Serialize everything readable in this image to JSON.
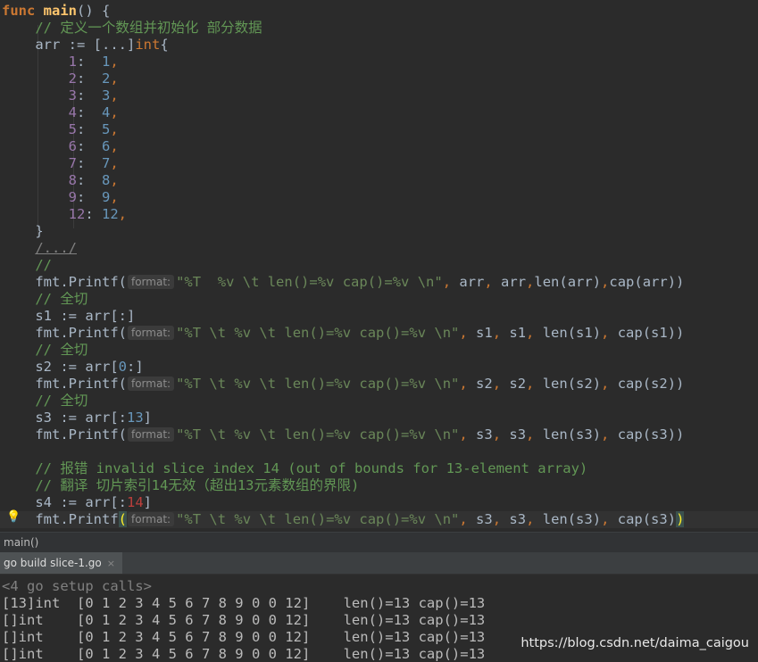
{
  "editor": {
    "lines": [
      {
        "indent": "",
        "parts": [
          {
            "t": "func",
            "c": "kw"
          },
          {
            "t": " "
          },
          {
            "t": "main",
            "c": "fn"
          },
          {
            "t": "() {"
          }
        ]
      },
      {
        "indent": "    ",
        "parts": [
          {
            "t": "// 定义一个数组并初始化 部分数据",
            "c": "cm"
          }
        ]
      },
      {
        "indent": "    ",
        "parts": [
          {
            "t": "arr := [...]"
          },
          {
            "t": "int",
            "c": "kw2"
          },
          {
            "t": "{"
          }
        ]
      },
      {
        "indent": "        ",
        "parts": [
          {
            "t": "1",
            "c": "key"
          },
          {
            "t": ":  "
          },
          {
            "t": "1",
            "c": "num"
          },
          {
            "t": ",",
            "c": "punc"
          }
        ]
      },
      {
        "indent": "        ",
        "parts": [
          {
            "t": "2",
            "c": "key"
          },
          {
            "t": ":  "
          },
          {
            "t": "2",
            "c": "num"
          },
          {
            "t": ",",
            "c": "punc"
          }
        ]
      },
      {
        "indent": "        ",
        "parts": [
          {
            "t": "3",
            "c": "key"
          },
          {
            "t": ":  "
          },
          {
            "t": "3",
            "c": "num"
          },
          {
            "t": ",",
            "c": "punc"
          }
        ]
      },
      {
        "indent": "        ",
        "parts": [
          {
            "t": "4",
            "c": "key"
          },
          {
            "t": ":  "
          },
          {
            "t": "4",
            "c": "num"
          },
          {
            "t": ",",
            "c": "punc"
          }
        ]
      },
      {
        "indent": "        ",
        "parts": [
          {
            "t": "5",
            "c": "key"
          },
          {
            "t": ":  "
          },
          {
            "t": "5",
            "c": "num"
          },
          {
            "t": ",",
            "c": "punc"
          }
        ]
      },
      {
        "indent": "        ",
        "parts": [
          {
            "t": "6",
            "c": "key"
          },
          {
            "t": ":  "
          },
          {
            "t": "6",
            "c": "num"
          },
          {
            "t": ",",
            "c": "punc"
          }
        ]
      },
      {
        "indent": "        ",
        "parts": [
          {
            "t": "7",
            "c": "key"
          },
          {
            "t": ":  "
          },
          {
            "t": "7",
            "c": "num"
          },
          {
            "t": ",",
            "c": "punc"
          }
        ]
      },
      {
        "indent": "        ",
        "parts": [
          {
            "t": "8",
            "c": "key"
          },
          {
            "t": ":  "
          },
          {
            "t": "8",
            "c": "num"
          },
          {
            "t": ",",
            "c": "punc"
          }
        ]
      },
      {
        "indent": "        ",
        "parts": [
          {
            "t": "9",
            "c": "key"
          },
          {
            "t": ":  "
          },
          {
            "t": "9",
            "c": "num"
          },
          {
            "t": ",",
            "c": "punc"
          }
        ]
      },
      {
        "indent": "        ",
        "parts": [
          {
            "t": "12",
            "c": "key"
          },
          {
            "t": ": "
          },
          {
            "t": "12",
            "c": "num"
          },
          {
            "t": ",",
            "c": "punc"
          }
        ]
      },
      {
        "indent": "    ",
        "parts": [
          {
            "t": "}"
          }
        ]
      },
      {
        "indent": "    ",
        "parts": [
          {
            "t": "/.../",
            "c": "fold-comment"
          }
        ]
      },
      {
        "indent": "    ",
        "parts": [
          {
            "t": "//",
            "c": "cm"
          }
        ]
      },
      {
        "indent": "    ",
        "parts": [
          {
            "t": "fmt.Printf("
          },
          {
            "hint": "format:"
          },
          {
            "t": "\"%T  %v \\t len()=%v cap()=%v \\n\"",
            "c": "str"
          },
          {
            "t": ", ",
            "c": "punc"
          },
          {
            "t": "arr"
          },
          {
            "t": ", ",
            "c": "punc"
          },
          {
            "t": "arr"
          },
          {
            "t": ",",
            "c": "punc"
          },
          {
            "t": "len(arr)"
          },
          {
            "t": ",",
            "c": "punc"
          },
          {
            "t": "cap(arr))"
          }
        ]
      },
      {
        "indent": "    ",
        "parts": [
          {
            "t": "// 全切",
            "c": "cm"
          }
        ]
      },
      {
        "indent": "    ",
        "parts": [
          {
            "t": "s1 := arr[:]"
          }
        ]
      },
      {
        "indent": "    ",
        "parts": [
          {
            "t": "fmt.Printf("
          },
          {
            "hint": "format:"
          },
          {
            "t": "\"%T \\t %v \\t len()=%v cap()=%v \\n\"",
            "c": "str"
          },
          {
            "t": ", ",
            "c": "punc"
          },
          {
            "t": "s1"
          },
          {
            "t": ", ",
            "c": "punc"
          },
          {
            "t": "s1"
          },
          {
            "t": ", ",
            "c": "punc"
          },
          {
            "t": "len(s1)"
          },
          {
            "t": ", ",
            "c": "punc"
          },
          {
            "t": "cap(s1))"
          }
        ]
      },
      {
        "indent": "    ",
        "parts": [
          {
            "t": "// 全切",
            "c": "cm"
          }
        ]
      },
      {
        "indent": "    ",
        "parts": [
          {
            "t": "s2 := arr["
          },
          {
            "t": "0",
            "c": "num"
          },
          {
            "t": ":]"
          }
        ]
      },
      {
        "indent": "    ",
        "parts": [
          {
            "t": "fmt.Printf("
          },
          {
            "hint": "format:"
          },
          {
            "t": "\"%T \\t %v \\t len()=%v cap()=%v \\n\"",
            "c": "str"
          },
          {
            "t": ", ",
            "c": "punc"
          },
          {
            "t": "s2"
          },
          {
            "t": ", ",
            "c": "punc"
          },
          {
            "t": "s2"
          },
          {
            "t": ", ",
            "c": "punc"
          },
          {
            "t": "len(s2)"
          },
          {
            "t": ", ",
            "c": "punc"
          },
          {
            "t": "cap(s2))"
          }
        ]
      },
      {
        "indent": "    ",
        "parts": [
          {
            "t": "// 全切",
            "c": "cm"
          }
        ]
      },
      {
        "indent": "    ",
        "parts": [
          {
            "t": "s3 := arr[:"
          },
          {
            "t": "13",
            "c": "num"
          },
          {
            "t": "]"
          }
        ]
      },
      {
        "indent": "    ",
        "parts": [
          {
            "t": "fmt.Printf("
          },
          {
            "hint": "format:"
          },
          {
            "t": "\"%T \\t %v \\t len()=%v cap()=%v \\n\"",
            "c": "str"
          },
          {
            "t": ", ",
            "c": "punc"
          },
          {
            "t": "s3"
          },
          {
            "t": ", ",
            "c": "punc"
          },
          {
            "t": "s3"
          },
          {
            "t": ", ",
            "c": "punc"
          },
          {
            "t": "len(s3)"
          },
          {
            "t": ", ",
            "c": "punc"
          },
          {
            "t": "cap(s3))"
          }
        ]
      },
      {
        "indent": "",
        "parts": []
      },
      {
        "indent": "    ",
        "parts": [
          {
            "t": "// 报错 invalid slice index 14 (out of bounds for 13-element array)",
            "c": "cm"
          }
        ]
      },
      {
        "indent": "    ",
        "parts": [
          {
            "t": "// 翻译 切片索引14无效（超出13元素数组的界限)",
            "c": "cm"
          }
        ]
      },
      {
        "indent": "    ",
        "parts": [
          {
            "t": "s4 := arr[:"
          },
          {
            "t": "14",
            "c": "red"
          },
          {
            "t": "]"
          }
        ]
      },
      {
        "indent": "    ",
        "caret": true,
        "parts": [
          {
            "t": "fmt.Printf"
          },
          {
            "t": "(",
            "c": "bracket-hl"
          },
          {
            "hint": "format:"
          },
          {
            "t": "\"%T \\t %v \\t len()=%v cap()=%v \\n\"",
            "c": "str"
          },
          {
            "t": ", ",
            "c": "punc"
          },
          {
            "t": "s3"
          },
          {
            "t": ", ",
            "c": "punc"
          },
          {
            "t": "s3"
          },
          {
            "t": ", ",
            "c": "punc"
          },
          {
            "t": "len(s3)"
          },
          {
            "t": ", ",
            "c": "punc"
          },
          {
            "t": "cap(s3)"
          },
          {
            "t": ")",
            "c": "bracket-hl"
          }
        ]
      }
    ]
  },
  "breadcrumb": {
    "label": "main()"
  },
  "run_panel": {
    "tab_label": "go build slice-1.go",
    "tab_close": "×"
  },
  "console": {
    "lines": [
      {
        "text": "<4 go setup calls>",
        "sys": true
      },
      {
        "text": "[13]int  [0 1 2 3 4 5 6 7 8 9 0 0 12]    len()=13 cap()=13"
      },
      {
        "text": "[]int    [0 1 2 3 4 5 6 7 8 9 0 0 12]    len()=13 cap()=13"
      },
      {
        "text": "[]int    [0 1 2 3 4 5 6 7 8 9 0 0 12]    len()=13 cap()=13"
      },
      {
        "text": "[]int    [0 1 2 3 4 5 6 7 8 9 0 0 12]    len()=13 cap()=13"
      }
    ]
  },
  "watermark": "https://blog.csdn.net/daima_caigou",
  "theme": {
    "background": "#2b2b2b",
    "keyword": "#cc7832",
    "function": "#ffc66d",
    "comment": "#629755",
    "string": "#6a8759",
    "number": "#6897bb",
    "field_key": "#9876aa",
    "error": "#bc3f3c"
  }
}
